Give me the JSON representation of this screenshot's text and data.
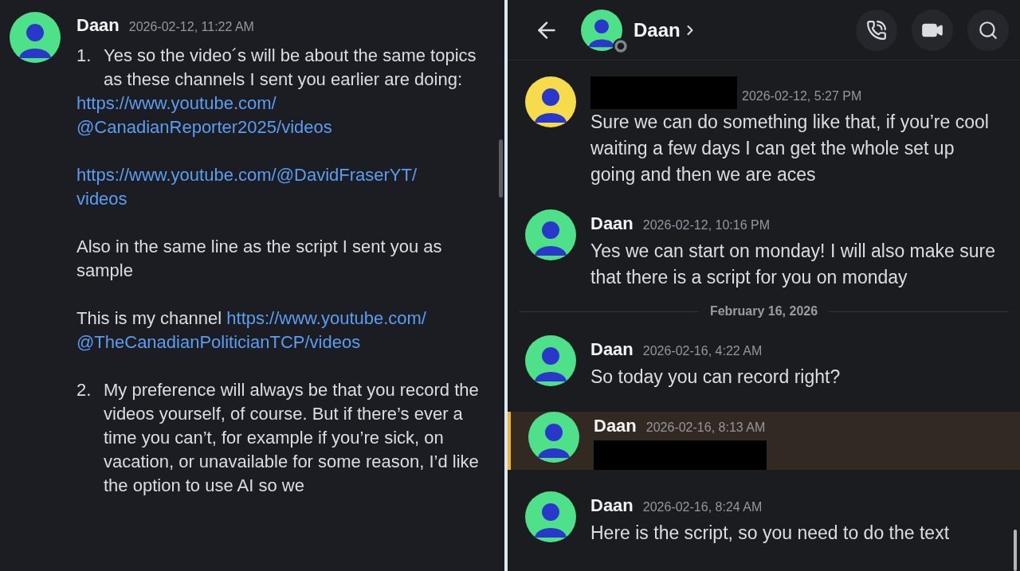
{
  "left_pane": {
    "message": {
      "author": "Daan",
      "timestamp": "2026-02-12, 11:22 AM",
      "color": "#4fe08a",
      "blocks": [
        {
          "kind": "list_item",
          "number": "1.",
          "text": "Yes so the video´s will be about the same topics as these channels I sent you earlier are doing:"
        },
        {
          "kind": "link",
          "lines": [
            "https://www.youtube.com/",
            "@CanadianReporter2025/videos"
          ]
        },
        {
          "kind": "link",
          "lines": [
            "https://www.youtube.com/@DavidFraserYT/",
            "videos"
          ]
        },
        {
          "kind": "paragraph",
          "text": "Also in the same line as the script I sent you as sample"
        },
        {
          "kind": "paragraph",
          "text": "This is my channel",
          "link_lines": [
            "https://www.youtube.com/",
            "@TheCanadianPoliticianTCP/videos"
          ]
        },
        {
          "kind": "list_item",
          "number": "2.",
          "text": "My preference will always be that you record the videos yourself, of course. But if there’s ever a time you can’t, for example if you’re sick, on vacation, or unavailable for some reason,  I’d like the option to use AI so we"
        }
      ]
    }
  },
  "right_pane": {
    "header": {
      "title": "Daan"
    },
    "items": [
      {
        "kind": "message",
        "author_redacted": true,
        "timestamp": "2026-02-12, 5:27 PM",
        "color": "#f6dc4c",
        "highlighted": false,
        "content_redacted": false,
        "text": "Sure we can do something like that, if you’re cool waiting a few days I can get the whole set up going and then we are aces"
      },
      {
        "kind": "message",
        "author_redacted": false,
        "author": "Daan",
        "timestamp": "2026-02-12, 10:16 PM",
        "color": "#4fe08a",
        "highlighted": false,
        "content_redacted": false,
        "text": "Yes we can start on monday! I will also make sure that there is a script for you on monday"
      },
      {
        "kind": "date_divider",
        "text": "February 16, 2026"
      },
      {
        "kind": "message",
        "author_redacted": false,
        "author": "Daan",
        "timestamp": "2026-02-16, 4:22 AM",
        "color": "#4fe08a",
        "highlighted": false,
        "content_redacted": false,
        "text": "So today you can record right?"
      },
      {
        "kind": "message",
        "author_redacted": false,
        "author": "Daan",
        "timestamp": "2026-02-16, 8:13 AM",
        "color": "#4fe08a",
        "highlighted": true,
        "content_redacted": true
      },
      {
        "kind": "message",
        "author_redacted": false,
        "author": "Daan",
        "timestamp": "2026-02-16, 8:24 AM",
        "color": "#4fe08a",
        "highlighted": false,
        "content_redacted": false,
        "text": "Here is the script, so you need to do the text"
      }
    ]
  }
}
